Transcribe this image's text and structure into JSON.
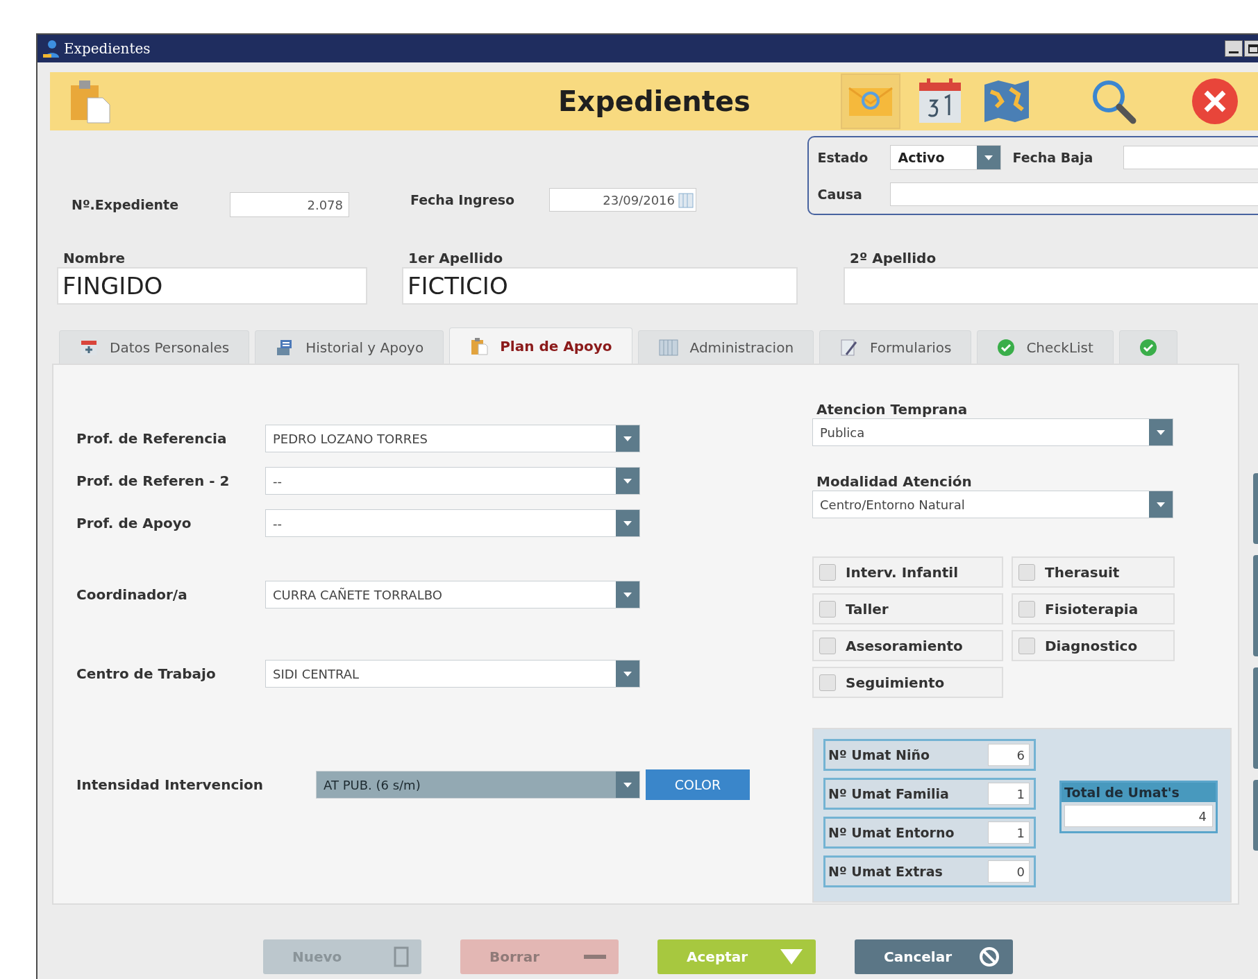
{
  "window": {
    "title": "Expedientes"
  },
  "header": {
    "title": "Expedientes"
  },
  "status": {
    "estado_label": "Estado",
    "estado_value": "Activo",
    "fecha_baja_label": "Fecha Baja",
    "causa_label": "Causa"
  },
  "expediente": {
    "label": "Nº.Expediente",
    "value": "2.078"
  },
  "fecha_ingreso": {
    "label": "Fecha Ingreso",
    "value": "23/09/2016"
  },
  "names": [
    {
      "label": "Nombre",
      "value": "FINGIDO"
    },
    {
      "label": "1er Apellido",
      "value": "FICTICIO"
    },
    {
      "label": "2º Apellido"
    }
  ],
  "tabs": [
    {
      "label": "Datos Personales",
      "selected": false
    },
    {
      "label": "Historial y Apoyo",
      "selected": false
    },
    {
      "label": "Plan de Apoyo",
      "selected": true
    },
    {
      "label": "Administracion",
      "selected": false
    },
    {
      "label": "Formularios",
      "selected": false
    },
    {
      "label": "CheckList",
      "selected": false
    },
    {
      "selected": false
    }
  ],
  "left_fields": [
    {
      "label": "Prof. de Referencia",
      "value": "PEDRO LOZANO TORRES"
    },
    {
      "label": "Prof. de Referen - 2",
      "value": "--"
    },
    {
      "label": "Prof. de Apoyo",
      "value": "--"
    },
    {
      "label": "Coordinador/a",
      "value": "CURRA CAÑETE TORRALBO"
    },
    {
      "label": "Centro de Trabajo",
      "value": "SIDI CENTRAL"
    }
  ],
  "intensidad": {
    "label": "Intensidad Intervencion",
    "value": "AT PUB. (6 s/m)",
    "button": "COLOR"
  },
  "right_dropdowns": [
    {
      "label": "Atencion Temprana",
      "value": "Publica"
    },
    {
      "label": "Modalidad Atención",
      "value": "Centro/Entorno Natural"
    }
  ],
  "services": [
    {
      "label": "Interv. Infantil",
      "checked": false
    },
    {
      "label": "Therasuit",
      "checked": false
    },
    {
      "label": "Taller",
      "checked": false
    },
    {
      "label": "Fisioterapia",
      "checked": false
    },
    {
      "label": "Asesoramiento",
      "checked": false
    },
    {
      "label": "Diagnostico",
      "checked": false
    },
    {
      "label": "Seguimiento",
      "checked": false
    }
  ],
  "umats": [
    {
      "label": "Nº Umat Niño",
      "value": "6"
    },
    {
      "label": "Nº Umat Familia",
      "value": "1"
    },
    {
      "label": "Nº Umat Entorno",
      "value": "1"
    },
    {
      "label": "Nº Umat Extras",
      "value": "0"
    }
  ],
  "total": {
    "label": "Total de Umat's",
    "value": "4"
  },
  "actions": [
    {
      "label": "Nuevo",
      "kind": "new",
      "disabled": true
    },
    {
      "label": "Borrar",
      "kind": "delete",
      "disabled": true
    },
    {
      "label": "Aceptar",
      "kind": "accept",
      "disabled": false
    },
    {
      "label": "Cancelar",
      "kind": "cancel",
      "disabled": false
    }
  ]
}
